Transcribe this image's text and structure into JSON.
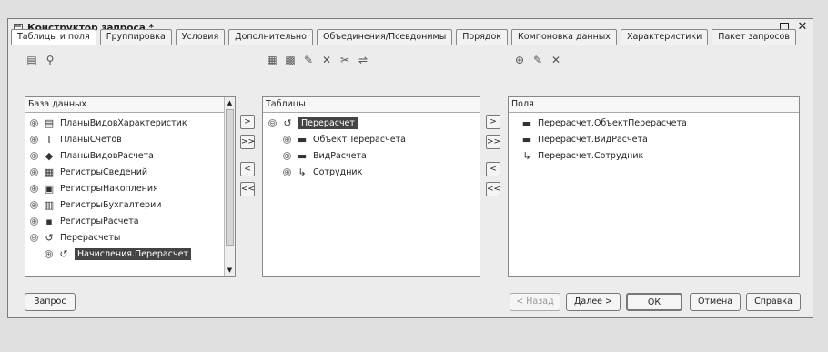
{
  "window": {
    "title": "Конструктор запроса *"
  },
  "tabs": [
    "Таблицы и поля",
    "Группировка",
    "Условия",
    "Дополнительно",
    "Объединения/Псевдонимы",
    "Порядок",
    "Компоновка данных",
    "Характеристики",
    "Пакет запросов"
  ],
  "database_panel": {
    "header": "База данных",
    "items": [
      {
        "expander": "⊕",
        "icon": "▤",
        "label": "ПланыВидовХарактеристик"
      },
      {
        "expander": "⊕",
        "icon": "Т",
        "label": "ПланыСчетов"
      },
      {
        "expander": "⊕",
        "icon": "◆",
        "label": "ПланыВидовРасчета"
      },
      {
        "expander": "⊕",
        "icon": "▦",
        "label": "РегистрыСведений"
      },
      {
        "expander": "⊕",
        "icon": "▣",
        "label": "РегистрыНакопления"
      },
      {
        "expander": "⊕",
        "icon": "▥",
        "label": "РегистрыБухгалтерии"
      },
      {
        "expander": "⊕",
        "icon": "▪",
        "label": "РегистрыРасчета"
      },
      {
        "expander": "⊖",
        "icon": "↺",
        "label": "Перерасчеты"
      },
      {
        "expander": "⊕",
        "icon": "↺",
        "label": "Начисления.Перерасчет"
      }
    ]
  },
  "tables_panel": {
    "header": "Таблицы",
    "items": [
      {
        "expander": "⊖",
        "icon": "↺",
        "label": "Перерасчет"
      },
      {
        "expander": "⊕",
        "icon": "▬",
        "label": "ОбъектПерерасчета"
      },
      {
        "expander": "⊕",
        "icon": "▬",
        "label": "ВидРасчета"
      },
      {
        "expander": "⊕",
        "icon": "↳",
        "label": "Сотрудник"
      }
    ]
  },
  "fields_panel": {
    "header": "Поля",
    "items": [
      {
        "icon": "▬",
        "label": "Перерасчет.ОбъектПерерасчета"
      },
      {
        "icon": "▬",
        "label": "Перерасчет.ВидРасчета"
      },
      {
        "icon": "↳",
        "label": "Перерасчет.Сотрудник"
      }
    ]
  },
  "transfer_buttons": {
    "add": ">",
    "add_all": ">>",
    "remove": "<",
    "remove_all": "<<"
  },
  "footer": {
    "query": "Запрос",
    "back": "< Назад",
    "next": "Далее >",
    "ok": "ОК",
    "cancel": "Отмена",
    "help": "Справка"
  }
}
